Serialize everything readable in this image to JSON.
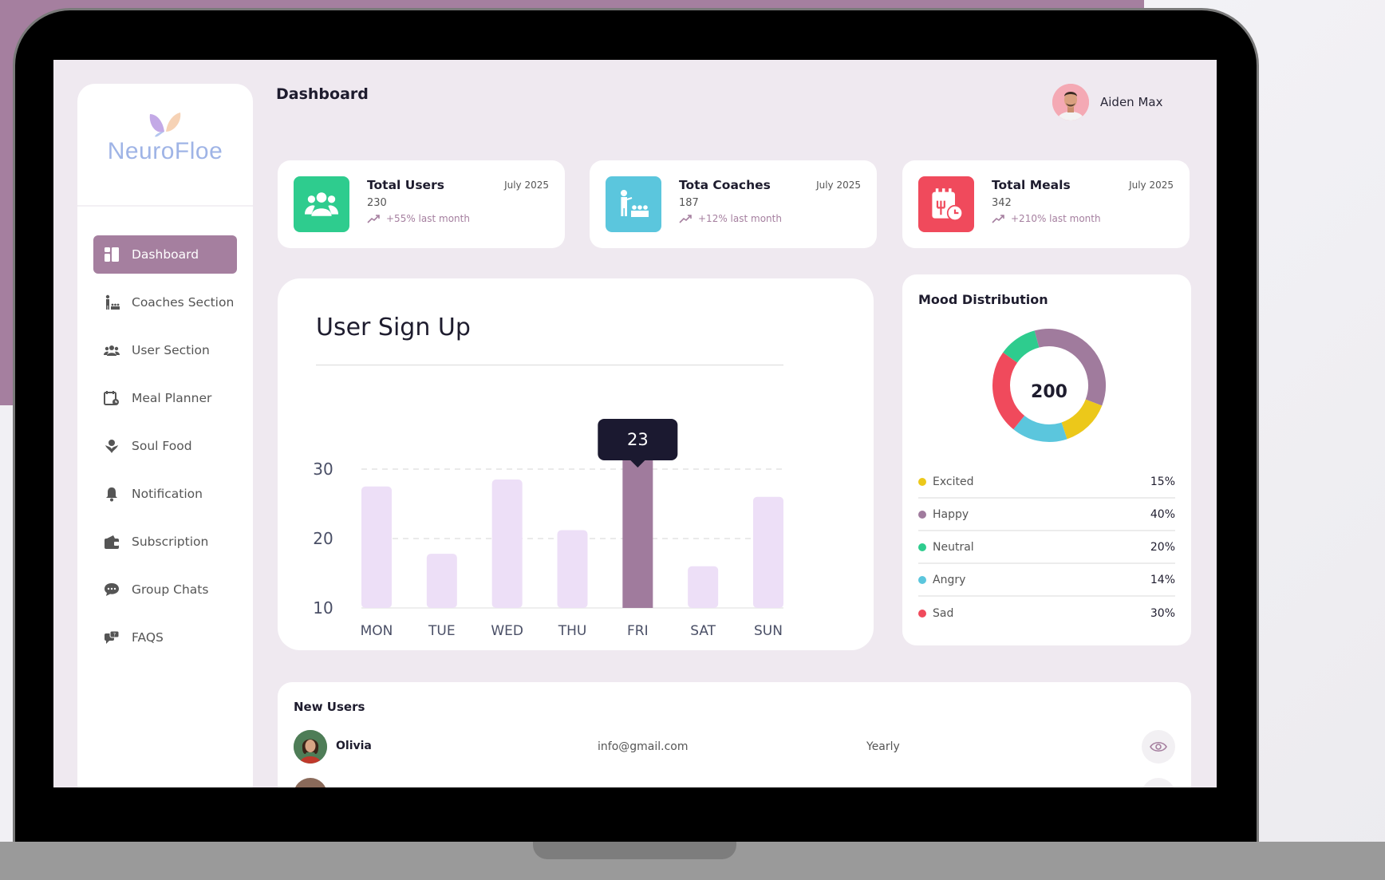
{
  "brand": {
    "name": "NeuroFloe"
  },
  "header": {
    "title": "Dashboard",
    "user_name": "Aiden Max"
  },
  "sidebar": {
    "items": [
      {
        "label": "Dashboard",
        "icon": "dashboard-icon",
        "active": true
      },
      {
        "label": "Coaches Section",
        "icon": "coach-icon"
      },
      {
        "label": "User Section",
        "icon": "users-icon"
      },
      {
        "label": "Meal Planner",
        "icon": "meal-icon"
      },
      {
        "label": "Soul Food",
        "icon": "soul-food-icon"
      },
      {
        "label": "Notification",
        "icon": "bell-icon"
      },
      {
        "label": "Subscription",
        "icon": "wallet-icon"
      },
      {
        "label": "Group Chats",
        "icon": "chat-icon"
      },
      {
        "label": "FAQS",
        "icon": "faq-icon"
      }
    ]
  },
  "stats": [
    {
      "title": "Total Users",
      "date": "July 2025",
      "value": "230",
      "trend": "+55% last month",
      "color": "#2ecc8e",
      "icon": "users-icon"
    },
    {
      "title": "Tota Coaches",
      "date": "July 2025",
      "value": "187",
      "trend": "+12% last month",
      "color": "#5bc6dd",
      "icon": "coach-icon"
    },
    {
      "title": "Total Meals",
      "date": "July 2025",
      "value": "342",
      "trend": "+210% last month",
      "color": "#f04a5c",
      "icon": "meal-icon"
    }
  ],
  "chart_data": {
    "type": "bar",
    "title": "User Sign Up",
    "categories": [
      "MON",
      "TUE",
      "WED",
      "THU",
      "FRI",
      "SAT",
      "SUN"
    ],
    "values": [
      27.5,
      17.8,
      28.5,
      21.2,
      31.5,
      16,
      26
    ],
    "ylim": [
      10,
      45
    ],
    "yticks": [
      10,
      20,
      30
    ],
    "highlight_index": 4,
    "tooltip": "23",
    "colors": {
      "bar": "#eddff7",
      "highlight": "#a07b9d",
      "tooltip": "#1b1930"
    }
  },
  "mood": {
    "title": "Mood Distribution",
    "total": "200",
    "items": [
      {
        "label": "Excited",
        "percent": "15%",
        "color": "#ecc81a"
      },
      {
        "label": "Happy",
        "percent": "40%",
        "color": "#a07b9d"
      },
      {
        "label": "Neutral",
        "percent": "20%",
        "color": "#2ecc8e"
      },
      {
        "label": "Angry",
        "percent": "14%",
        "color": "#5bc6dd"
      },
      {
        "label": "Sad",
        "percent": "30%",
        "color": "#f04a5c"
      }
    ]
  },
  "new_users": {
    "title": "New Users",
    "rows": [
      {
        "name": "Olivia",
        "email": "info@gmail.com",
        "plan": "Yearly"
      }
    ]
  }
}
